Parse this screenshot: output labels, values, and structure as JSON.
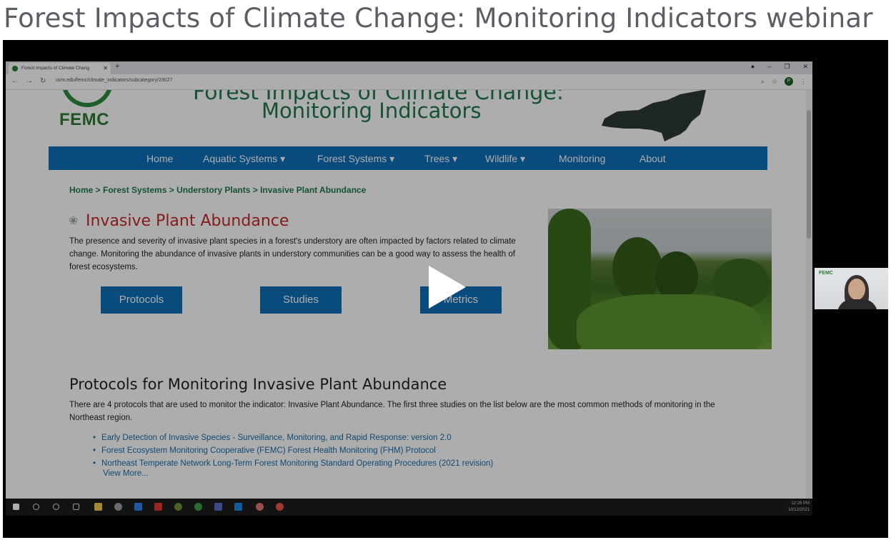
{
  "page_title": "Forest Impacts of Climate Change: Monitoring Indicators webinar",
  "browser": {
    "tab_title": "Forest Impacts of Climate Chang",
    "url": "uvm.edu/femc/climate_indicators/subcategory/2/8/27"
  },
  "site": {
    "logo_text": "FEMC",
    "title_cutoff": "Forest Impacts of Climate Change:",
    "title": "Monitoring Indicators",
    "nav": [
      {
        "label": "Home"
      },
      {
        "label": "Aquatic Systems ▾"
      },
      {
        "label": "Forest Systems ▾"
      },
      {
        "label": "Trees ▾"
      },
      {
        "label": "Wildlife ▾"
      },
      {
        "label": "Monitoring"
      },
      {
        "label": "About"
      }
    ],
    "breadcrumb": "Home > Forest Systems > Understory Plants > Invasive Plant Abundance"
  },
  "indicator": {
    "title": "Invasive Plant Abundance",
    "description": "The presence and severity of invasive plant species in a forest's understory are often impacted by factors related to climate change. Monitoring the abundance of invasive plants in understory communities can be a good way to assess the health of forest ecosystems.",
    "buttons": [
      "Protocols",
      "Studies",
      "Metrics"
    ]
  },
  "protocols": {
    "title": "Protocols for Monitoring Invasive Plant Abundance",
    "description": "There are 4 protocols that are used to monitor the indicator: Invasive Plant Abundance. The first three studies on the list below are the most common methods of monitoring in the Northeast region.",
    "items": [
      "Early Detection of Invasive Species - Surveillance, Monitoring, and Rapid Response: version 2.0",
      "Forest Ecosystem Monitoring Cooperative (FEMC) Forest Health Monitoring (FHM) Protocol",
      "Northeast Temperate Network Long-Term Forest Monitoring Standard Operating Procedures (2021 revision)"
    ],
    "view_more": "View More..."
  },
  "taskbar": {
    "time": "12:26 PM",
    "date": "10/12/2021"
  },
  "camera": {
    "logo": "FEMC"
  },
  "colors": {
    "femc_green": "#1f7a4a",
    "nav_blue": "#0f6fb8",
    "title_red": "#c62828"
  }
}
